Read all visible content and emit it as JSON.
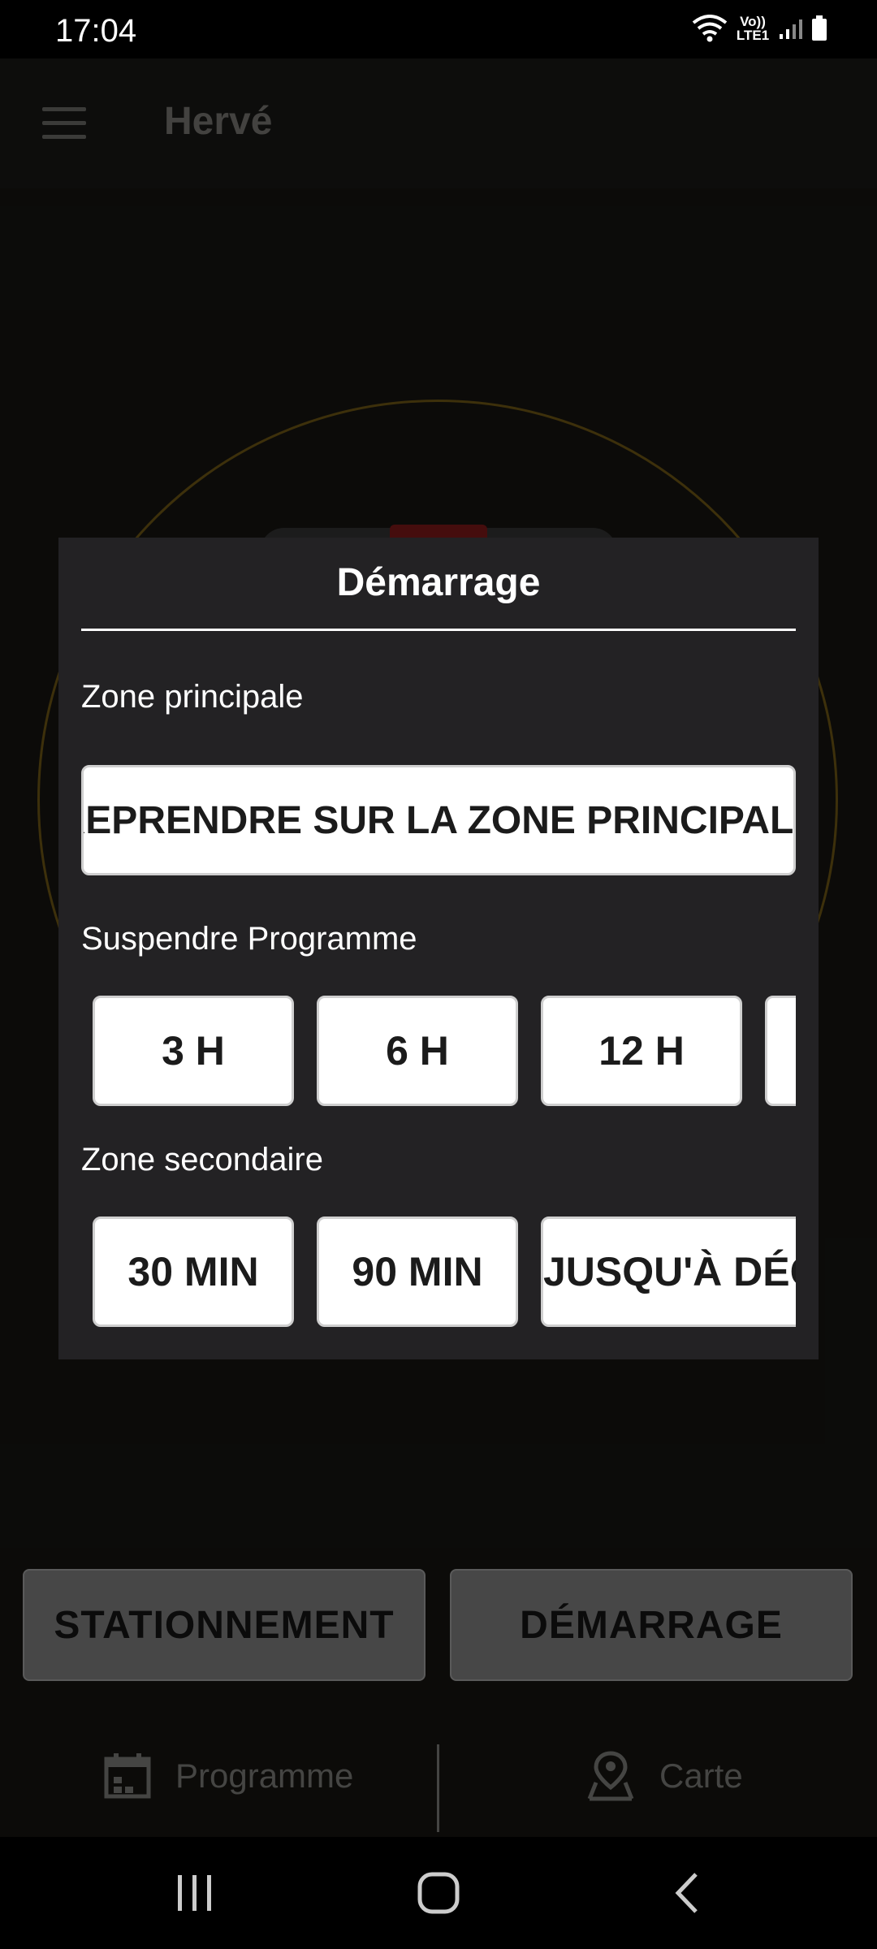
{
  "status_bar": {
    "time": "17:04",
    "network_label_top": "Vo))",
    "network_label_bottom": "LTE1"
  },
  "app": {
    "title": "Hervé"
  },
  "dialog": {
    "title": "Démarrage",
    "main_zone_label": "Zone principale",
    "resume_button": "REPRENDRE SUR LA ZONE PRINCIPALE",
    "suspend_label": "Suspendre Programme",
    "suspend_options": [
      "3 H",
      "6 H",
      "12 H",
      ""
    ],
    "secondary_label": "Zone secondaire",
    "secondary_options": [
      "30 MIN",
      "90 MIN",
      "JUSQU'À DÉCH"
    ]
  },
  "actions": {
    "park": "STATIONNEMENT",
    "start": "DÉMARRAGE"
  },
  "bottom_nav": {
    "schedule": "Programme",
    "map": "Carte"
  }
}
